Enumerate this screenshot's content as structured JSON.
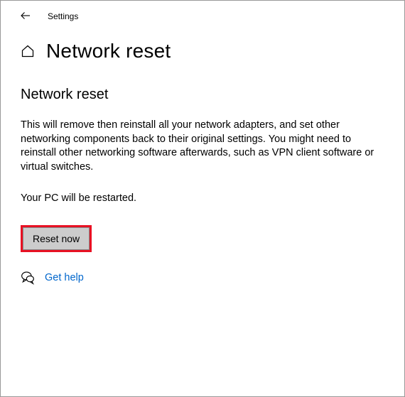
{
  "header": {
    "app_title": "Settings"
  },
  "page": {
    "title": "Network reset"
  },
  "section": {
    "heading": "Network reset",
    "description": "This will remove then reinstall all your network adapters, and set other networking components back to their original settings. You might need to reinstall other networking software afterwards, such as VPN client software or virtual switches.",
    "restart_note": "Your PC will be restarted."
  },
  "actions": {
    "reset_label": "Reset now"
  },
  "help": {
    "link_label": "Get help"
  }
}
